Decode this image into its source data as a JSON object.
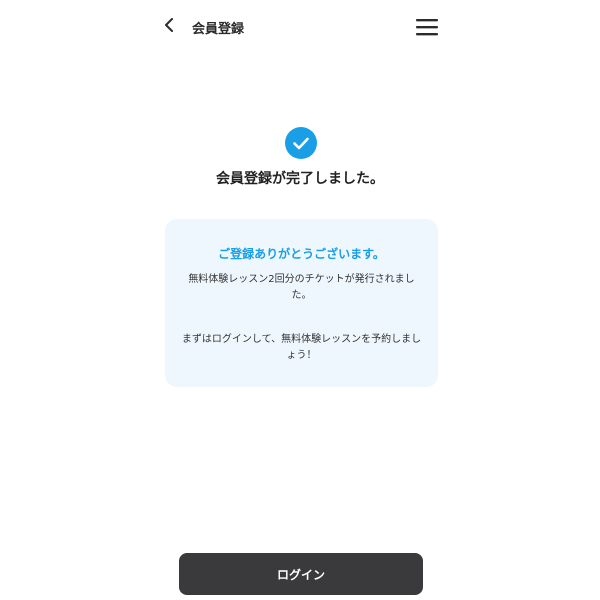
{
  "header": {
    "title": "会員登録",
    "back_icon": "chevron-left-icon",
    "menu_icon": "hamburger-menu-icon"
  },
  "status": {
    "icon": "check-circle-icon",
    "accent_color": "#1a9fe6",
    "title": "会員登録が完了しました。"
  },
  "message_card": {
    "heading": "ご登録ありがとうございます。",
    "line1": "無料体験レッスン2回分のチケットが発行されました。",
    "line2": "まずはログインして、無料体験レッスンを予約しましょう！",
    "background_color": "#eef7fd"
  },
  "actions": {
    "login_label": "ログイン",
    "button_color": "#3a3a3c"
  }
}
